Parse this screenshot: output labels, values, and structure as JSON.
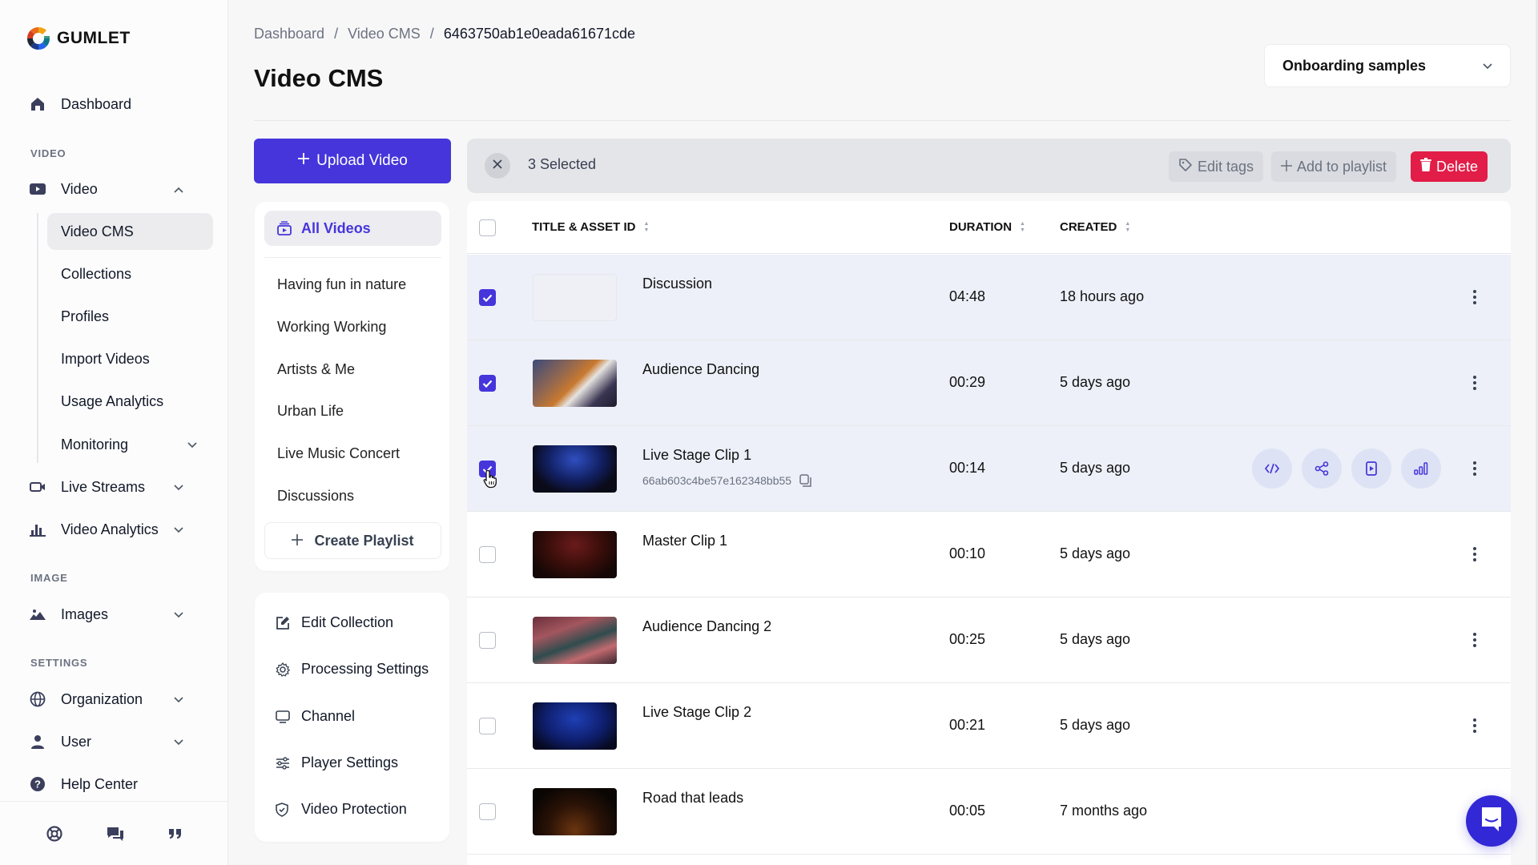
{
  "brand": {
    "name": "GUMLET",
    "accent": "#4535db",
    "danger": "#e11d48"
  },
  "sidebar": {
    "dashboard": "Dashboard",
    "sections": {
      "video": "VIDEO",
      "image": "IMAGE",
      "settings": "SETTINGS"
    },
    "video_item": "Video",
    "video_sub": [
      "Video CMS",
      "Collections",
      "Profiles",
      "Import Videos",
      "Usage Analytics",
      "Monitoring"
    ],
    "live_streams": "Live Streams",
    "video_analytics": "Video Analytics",
    "images": "Images",
    "organization": "Organization",
    "user": "User",
    "help_center": "Help Center",
    "footer_icons": [
      "lifebuoy-icon",
      "chat-icon",
      "quote-icon"
    ]
  },
  "header": {
    "breadcrumb": [
      "Dashboard",
      "Video CMS",
      "6463750ab1e0eada61671cde"
    ],
    "title": "Video CMS",
    "collection_select": "Onboarding samples"
  },
  "left_panel": {
    "upload_label": "Upload Video",
    "all_videos": "All Videos",
    "playlists": [
      "Having fun in nature",
      "Working Working",
      "Artists & Me",
      "Urban Life",
      "Live Music Concert",
      "Discussions"
    ],
    "create_playlist": "Create Playlist",
    "settings": [
      "Edit Collection",
      "Processing Settings",
      "Channel",
      "Player Settings",
      "Video Protection"
    ]
  },
  "bulk_bar": {
    "selected_text": "3 Selected",
    "edit_tags": "Edit tags",
    "add_to_playlist": "Add to playlist",
    "delete": "Delete"
  },
  "table": {
    "columns": {
      "title": "TITLE & ASSET ID",
      "duration": "DURATION",
      "created": "CREATED"
    },
    "rows": [
      {
        "title": "Discussion",
        "asset_id": "",
        "duration": "04:48",
        "created": "18 hours ago",
        "selected": true,
        "thumb": "empty"
      },
      {
        "title": "Audience Dancing",
        "asset_id": "",
        "duration": "00:29",
        "created": "5 days ago",
        "selected": true,
        "thumb": "dance"
      },
      {
        "title": "Live Stage Clip 1",
        "asset_id": "66ab603c4be57e162348bb55",
        "duration": "00:14",
        "created": "5 days ago",
        "selected": true,
        "thumb": "stage-blue",
        "hovered": true
      },
      {
        "title": "Master Clip 1",
        "asset_id": "",
        "duration": "00:10",
        "created": "5 days ago",
        "selected": false,
        "thumb": "stage-red"
      },
      {
        "title": "Audience Dancing 2",
        "asset_id": "",
        "duration": "00:25",
        "created": "5 days ago",
        "selected": false,
        "thumb": "crowd"
      },
      {
        "title": "Live Stage Clip 2",
        "asset_id": "",
        "duration": "00:21",
        "created": "5 days ago",
        "selected": false,
        "thumb": "stage-blue2"
      },
      {
        "title": "Road that leads",
        "asset_id": "",
        "duration": "00:05",
        "created": "7 months ago",
        "selected": false,
        "thumb": "night"
      }
    ],
    "row_actions": [
      "embed-code-icon",
      "share-icon",
      "play-preview-icon",
      "analytics-icon"
    ]
  }
}
